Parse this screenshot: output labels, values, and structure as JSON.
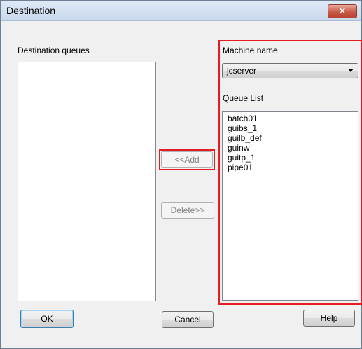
{
  "window": {
    "title": "Destination"
  },
  "left": {
    "label": "Destination queues",
    "items": []
  },
  "right": {
    "machine_label": "Machine name",
    "machine_value": "jcserver",
    "queue_label": "Queue List",
    "queue_items": [
      "batch01",
      "guibs_1",
      "guilb_def",
      "guinw",
      "guitp_1",
      "pipe01"
    ]
  },
  "buttons": {
    "add": "<<Add",
    "delete": "Delete>>",
    "ok": "OK",
    "cancel": "Cancel",
    "help": "Help"
  },
  "colors": {
    "highlight": "#e51c24",
    "titlebar": "#c9d9ec",
    "close_button": "#c75a45"
  },
  "icons": {
    "close": "close-icon"
  }
}
